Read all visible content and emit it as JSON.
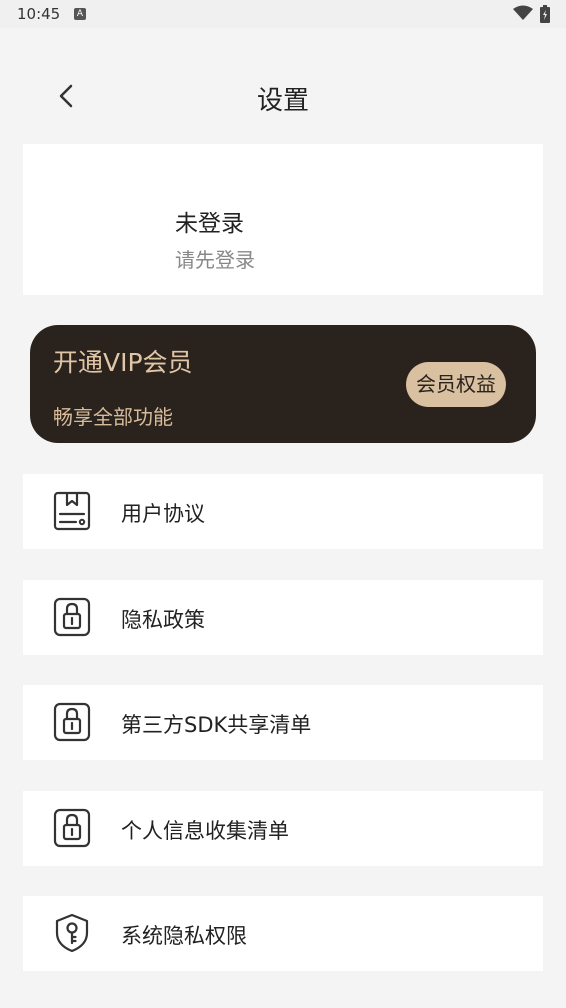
{
  "status_bar": {
    "time": "10:45",
    "notification_icon_letter": "A"
  },
  "header": {
    "title": "设置",
    "back_icon": "chevron-left-icon"
  },
  "user": {
    "name": "未登录",
    "hint": "请先登录"
  },
  "vip": {
    "title": "开通VIP会员",
    "subtitle": "畅享全部功能",
    "button_label": "会员权益",
    "colors": {
      "card": "#2a231d",
      "text": "#e1c6a6",
      "button": "#d9c0a0"
    }
  },
  "menu": {
    "items": [
      {
        "label": "用户协议",
        "icon": "agreement-document-icon"
      },
      {
        "label": "隐私政策",
        "icon": "lock-icon"
      },
      {
        "label": "第三方SDK共享清单",
        "icon": "lock-icon"
      },
      {
        "label": "个人信息收集清单",
        "icon": "lock-icon"
      },
      {
        "label": "系统隐私权限",
        "icon": "shield-key-icon"
      }
    ]
  }
}
